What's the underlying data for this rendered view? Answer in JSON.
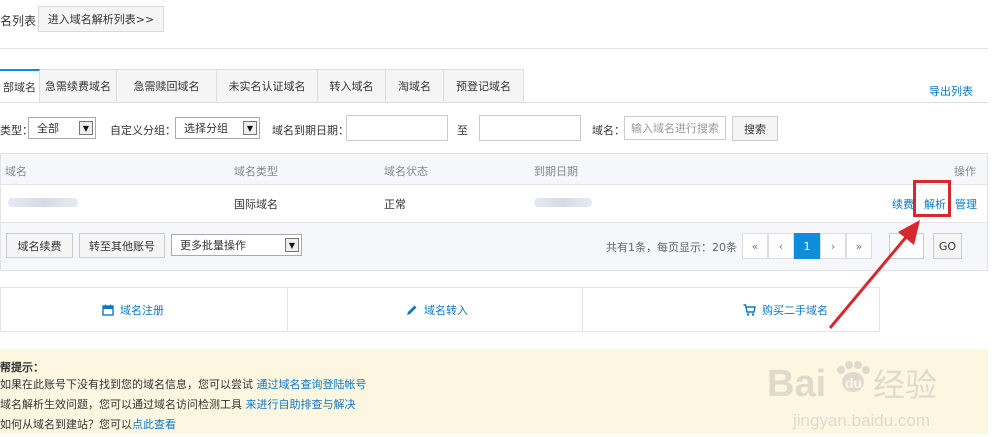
{
  "header": {
    "title": "名列表",
    "parse_list_button": "进入域名解析列表>>"
  },
  "tabs": [
    {
      "label": "部域名",
      "active": true
    },
    {
      "label": "急需续费域名",
      "active": false
    },
    {
      "label": "急需赎回域名",
      "active": false
    },
    {
      "label": "未实名认证域名",
      "active": false
    },
    {
      "label": "转入域名",
      "active": false
    },
    {
      "label": "淘域名",
      "active": false
    },
    {
      "label": "预登记域名",
      "active": false
    }
  ],
  "export_label": "导出列表",
  "filters": {
    "type_label": "类型：",
    "type_value": "全部",
    "group_label": "自定义分组：",
    "group_value": "选择分组",
    "expiry_label": "域名到期日期：",
    "range_sep": "至",
    "domain_label": "域名：",
    "domain_placeholder": "输入域名进行搜索",
    "search_button": "搜索"
  },
  "table": {
    "columns": [
      "域名",
      "域名类型",
      "域名状态",
      "到期日期",
      "操作"
    ],
    "rows": [
      {
        "type": "国际域名",
        "status": "正常",
        "actions": [
          "续费",
          "解析",
          "管理"
        ]
      }
    ]
  },
  "bulk": {
    "renew_button": "域名续费",
    "transfer_button": "转至其他账号",
    "more_select": "更多批量操作"
  },
  "pagination": {
    "summary": "共有1条，每页显示：20条",
    "first": "«",
    "prev": "‹",
    "current": "1",
    "next": "›",
    "last": "»",
    "go_button": "GO"
  },
  "actions": {
    "register": "域名注册",
    "transfer_in": "域名转入",
    "buy_second": "购买二手域名"
  },
  "notice": {
    "title": "帮提示：",
    "line1_text": "如果在此账号下没有找到您的域名信息，您可以尝试 ",
    "line1_link": "通过域名查询登陆帐号",
    "line2_text": "域名解析生效问题，您可以通过域名访问检测工具 ",
    "line2_link": "来进行自助排查与解决",
    "line3_text": "如何从域名到建站？您可以",
    "line3_link": "点此查看"
  },
  "watermark": {
    "brand": "Baidu经验",
    "url": "jingyan.baidu.com"
  },
  "colors": {
    "link": "#0e77c2",
    "accent": "#0e8ed8",
    "highlight": "#d7282f",
    "notice_bg": "#fdf6e0"
  }
}
